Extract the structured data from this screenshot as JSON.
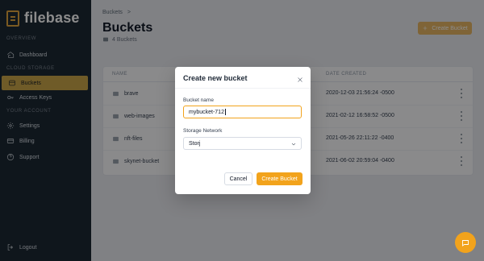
{
  "brand": {
    "name": "filebase"
  },
  "sidebar": {
    "sections": [
      {
        "label": "Overview"
      },
      {
        "label": "Cloud Storage"
      },
      {
        "label": "Your Account"
      }
    ],
    "items": [
      {
        "label": "Dashboard",
        "icon": "home-icon",
        "active": false
      },
      {
        "label": "Buckets",
        "icon": "buckets-icon",
        "active": true
      },
      {
        "label": "Access Keys",
        "icon": "key-icon",
        "active": false
      },
      {
        "label": "Settings",
        "icon": "gear-icon",
        "active": false
      },
      {
        "label": "Billing",
        "icon": "credit-card-icon",
        "active": false
      },
      {
        "label": "Support",
        "icon": "help-icon",
        "active": false
      }
    ],
    "logout": {
      "label": "Logout",
      "icon": "logout-icon"
    }
  },
  "page": {
    "breadcrumb": {
      "root": "Buckets",
      "separator": ">"
    },
    "title": "Buckets",
    "subtitle": "4 Buckets",
    "create_button_label": "Create Bucket"
  },
  "table": {
    "headers": {
      "name": "Name",
      "date": "Date Created"
    },
    "rows": [
      {
        "name": "brave",
        "date": "2020-12-03 21:56:24 -0500"
      },
      {
        "name": "web-images",
        "date": "2021-02-12 16:58:52 -0500"
      },
      {
        "name": "nft-files",
        "date": "2021-05-26 22:11:22 -0400"
      },
      {
        "name": "skynet-bucket",
        "date": "2021-06-02 20:59:04 -0400"
      }
    ]
  },
  "modal": {
    "title": "Create new bucket",
    "bucket_name_label": "Bucket name",
    "bucket_name_value": "mybucket-712",
    "network_label": "Storage Network",
    "network_value": "Storj",
    "cancel_label": "Cancel",
    "create_label": "Create Bucket"
  },
  "colors": {
    "accent": "#F2A31C",
    "sidebar_bg": "#1D2833",
    "overlay": "rgba(0,0,0,0.45)"
  }
}
